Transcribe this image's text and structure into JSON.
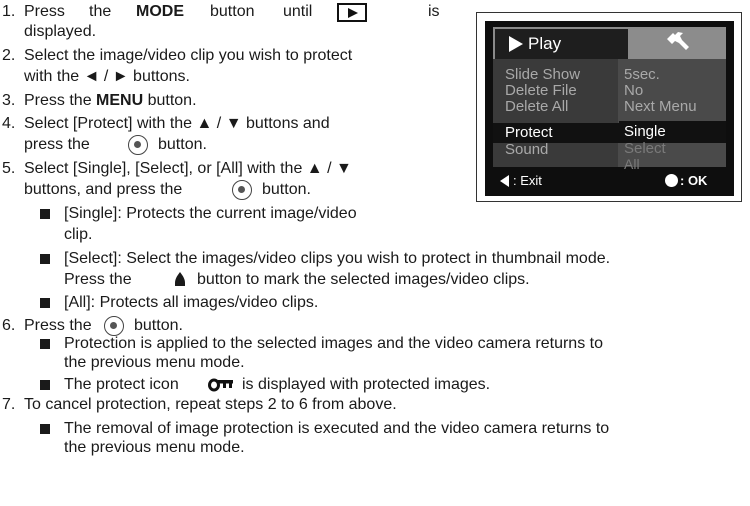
{
  "steps": [
    {
      "num": "1.",
      "line1": {
        "a": "Press",
        "b": "the",
        "bold": "MODE",
        "c": "button",
        "d": "until",
        "e": "is"
      },
      "line2": "displayed."
    },
    {
      "num": "2.",
      "line1": "Select the image/video clip you wish to protect",
      "line2": "with the ◄ / ► buttons."
    },
    {
      "num": "3.",
      "pre": "Press the ",
      "bold": "MENU",
      "post": " button."
    },
    {
      "num": "4.",
      "line1": "Select [Protect] with the ▲ / ▼ buttons and",
      "line2a": "press the",
      "line2b": "button."
    },
    {
      "num": "5.",
      "line1": "Select [Single], [Select], or [All] with the ▲ / ▼",
      "line2a": "buttons, and press the",
      "line2b": "button."
    },
    {
      "num": "6.",
      "pre": "Press the",
      "post": "button."
    },
    {
      "num": "7.",
      "text": "To cancel protection, repeat steps 2 to 6 from above."
    }
  ],
  "bullets5": {
    "single_1": "[Single]: Protects the current image/video",
    "single_2": "clip.",
    "select_1": "[Select]: Select the images/video clips you wish to protect in thumbnail mode.",
    "select_2a": "Press the",
    "select_2b": "button to mark the selected images/video clips.",
    "all": "[All]: Protects all images/video clips."
  },
  "bullets6": {
    "b1_1": "Protection is applied to the selected images and the video camera returns to",
    "b1_2": "the previous menu mode.",
    "b2a": "The protect icon",
    "b2b": "is displayed with protected images."
  },
  "bullets7": {
    "b1_1": "The removal of image protection is executed and the video camera returns to",
    "b1_2": "the previous menu mode."
  },
  "lcd": {
    "tab_label": "Play",
    "left_items": [
      "Slide Show",
      "Delete File",
      "Delete All",
      "Protect",
      "Sound"
    ],
    "right_items": [
      "5sec.",
      "No",
      "Next Menu",
      "Single",
      "Select",
      "All"
    ],
    "footer_exit": ": Exit",
    "footer_ok": ": OK"
  },
  "colors": {
    "lcd_bg": "#0e0e0e",
    "lcd_panel": "#3a3a3a",
    "lcd_text": "#a9a9a9",
    "lcd_tab2": "#8c8c8c"
  },
  "icons": [
    "play-mode-icon",
    "ok-button-icon",
    "protect-key-icon",
    "wrench-icon",
    "arrow-up-icon"
  ]
}
